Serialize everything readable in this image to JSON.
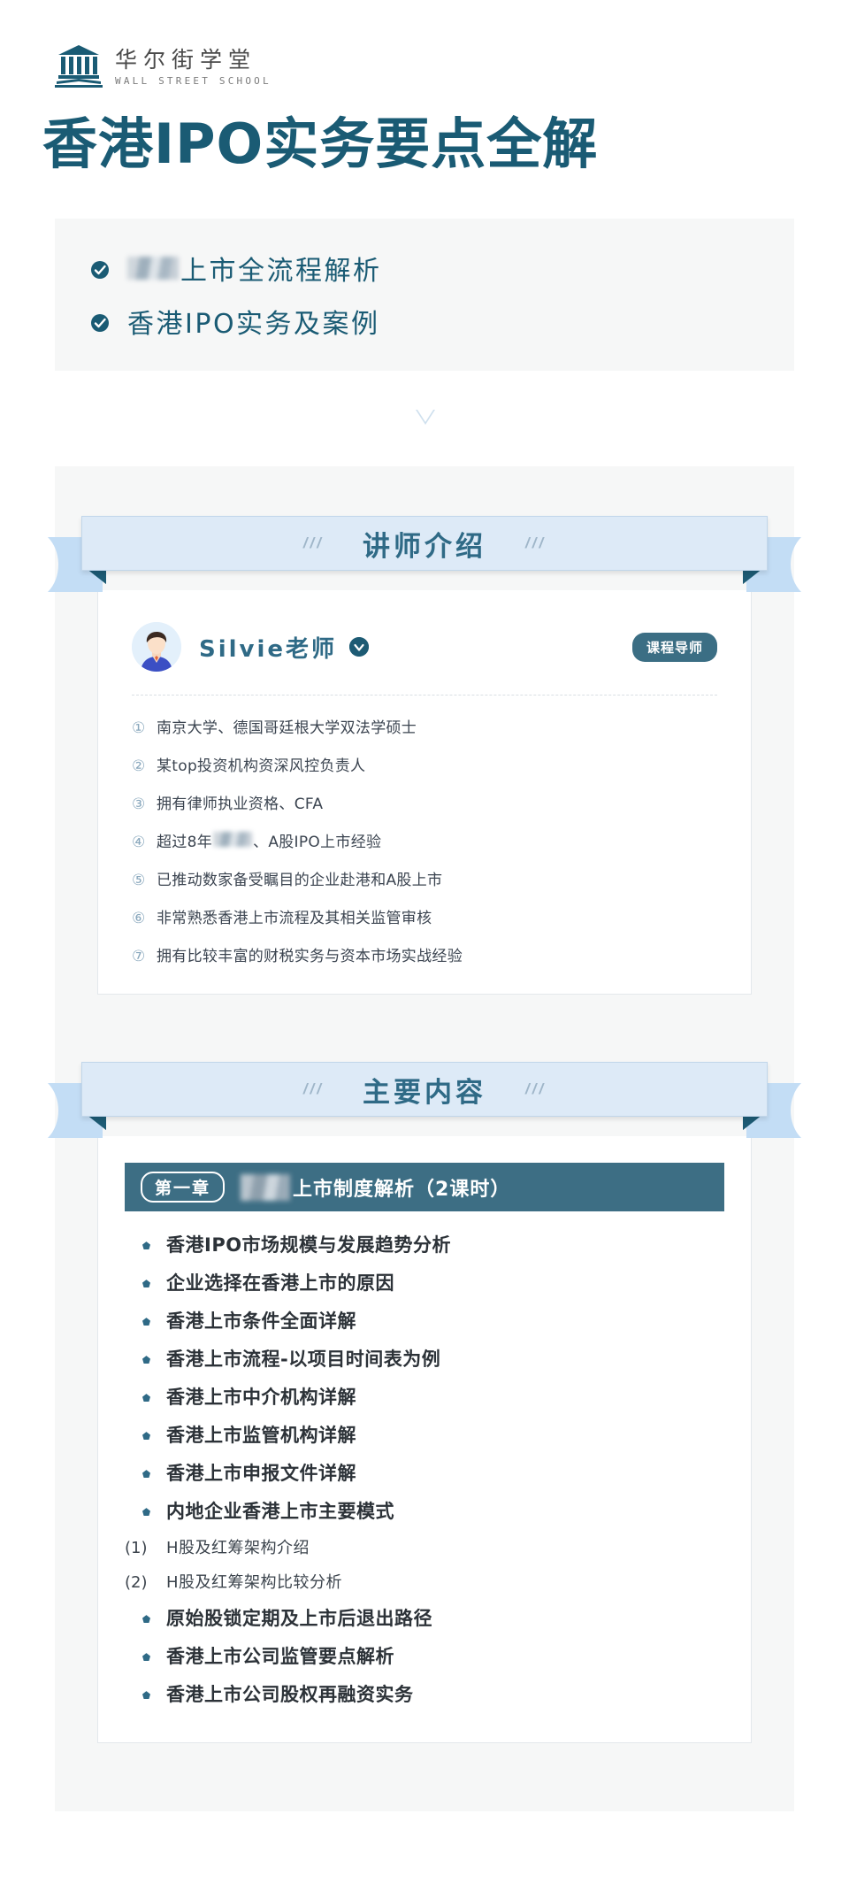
{
  "brand": {
    "name_cn": "华尔街学堂",
    "name_en": "WALL STREET SCHOOL",
    "logo_icon": "bank-columns-icon",
    "accent": "#1a5b74"
  },
  "hero": {
    "title": "香港IPO实务要点全解"
  },
  "highlights": {
    "check_icon": "check-circle-icon",
    "items": [
      {
        "blurred_prefix": true,
        "text": "上市全流程解析"
      },
      {
        "blurred_prefix": false,
        "text": "香港IPO实务及案例"
      }
    ]
  },
  "divider": {
    "icon": "triangle-down-icon"
  },
  "instructor_section": {
    "banner_title": "讲师介绍",
    "banner_decor_left": "///",
    "banner_decor_right": "///",
    "avatar_icon": "person-avatar-icon",
    "name": "Silvie老师",
    "verified_icon": "verified-check-icon",
    "badge": "课程导师",
    "bio": [
      {
        "num": "①",
        "text": "南京大学、德国哥廷根大学双法学硕士"
      },
      {
        "num": "②",
        "text": "某top投资机构资深风控负责人"
      },
      {
        "num": "③",
        "text": "拥有律师执业资格、CFA"
      },
      {
        "num": "④",
        "text_before": "超过8年",
        "blurred": true,
        "text_after": "、A股IPO上市经验"
      },
      {
        "num": "⑤",
        "text": "已推动数家备受瞩目的企业赴港和A股上市"
      },
      {
        "num": "⑥",
        "text": "非常熟悉香港上市流程及其相关监管审核"
      },
      {
        "num": "⑦",
        "text": "拥有比较丰富的财税实务与资本市场实战经验"
      }
    ]
  },
  "content_section": {
    "banner_title": "主要内容",
    "banner_decor_left": "///",
    "banner_decor_right": "///",
    "chapter": {
      "label": "第一章",
      "blurred_prefix": true,
      "title": "上市制度解析（2课时）"
    },
    "topics": [
      {
        "type": "bullet",
        "text": "香港IPO市场规模与发展趋势分析"
      },
      {
        "type": "bullet",
        "text": "企业选择在香港上市的原因"
      },
      {
        "type": "bullet",
        "text": "香港上市条件全面详解"
      },
      {
        "type": "bullet",
        "text": "香港上市流程-以项目时间表为例"
      },
      {
        "type": "bullet",
        "text": "香港上市中介机构详解"
      },
      {
        "type": "bullet",
        "text": "香港上市监管机构详解"
      },
      {
        "type": "bullet",
        "text": "香港上市申报文件详解"
      },
      {
        "type": "bullet",
        "text": "内地企业香港上市主要模式"
      },
      {
        "type": "sub",
        "num": "(1)",
        "text": "H股及红筹架构介绍"
      },
      {
        "type": "sub",
        "num": "(2)",
        "text": "H股及红筹架构比较分析"
      },
      {
        "type": "bullet",
        "text": "原始股锁定期及上市后退出路径"
      },
      {
        "type": "bullet",
        "text": "香港上市公司监管要点解析"
      },
      {
        "type": "bullet",
        "text": "香港上市公司股权再融资实务"
      }
    ]
  }
}
